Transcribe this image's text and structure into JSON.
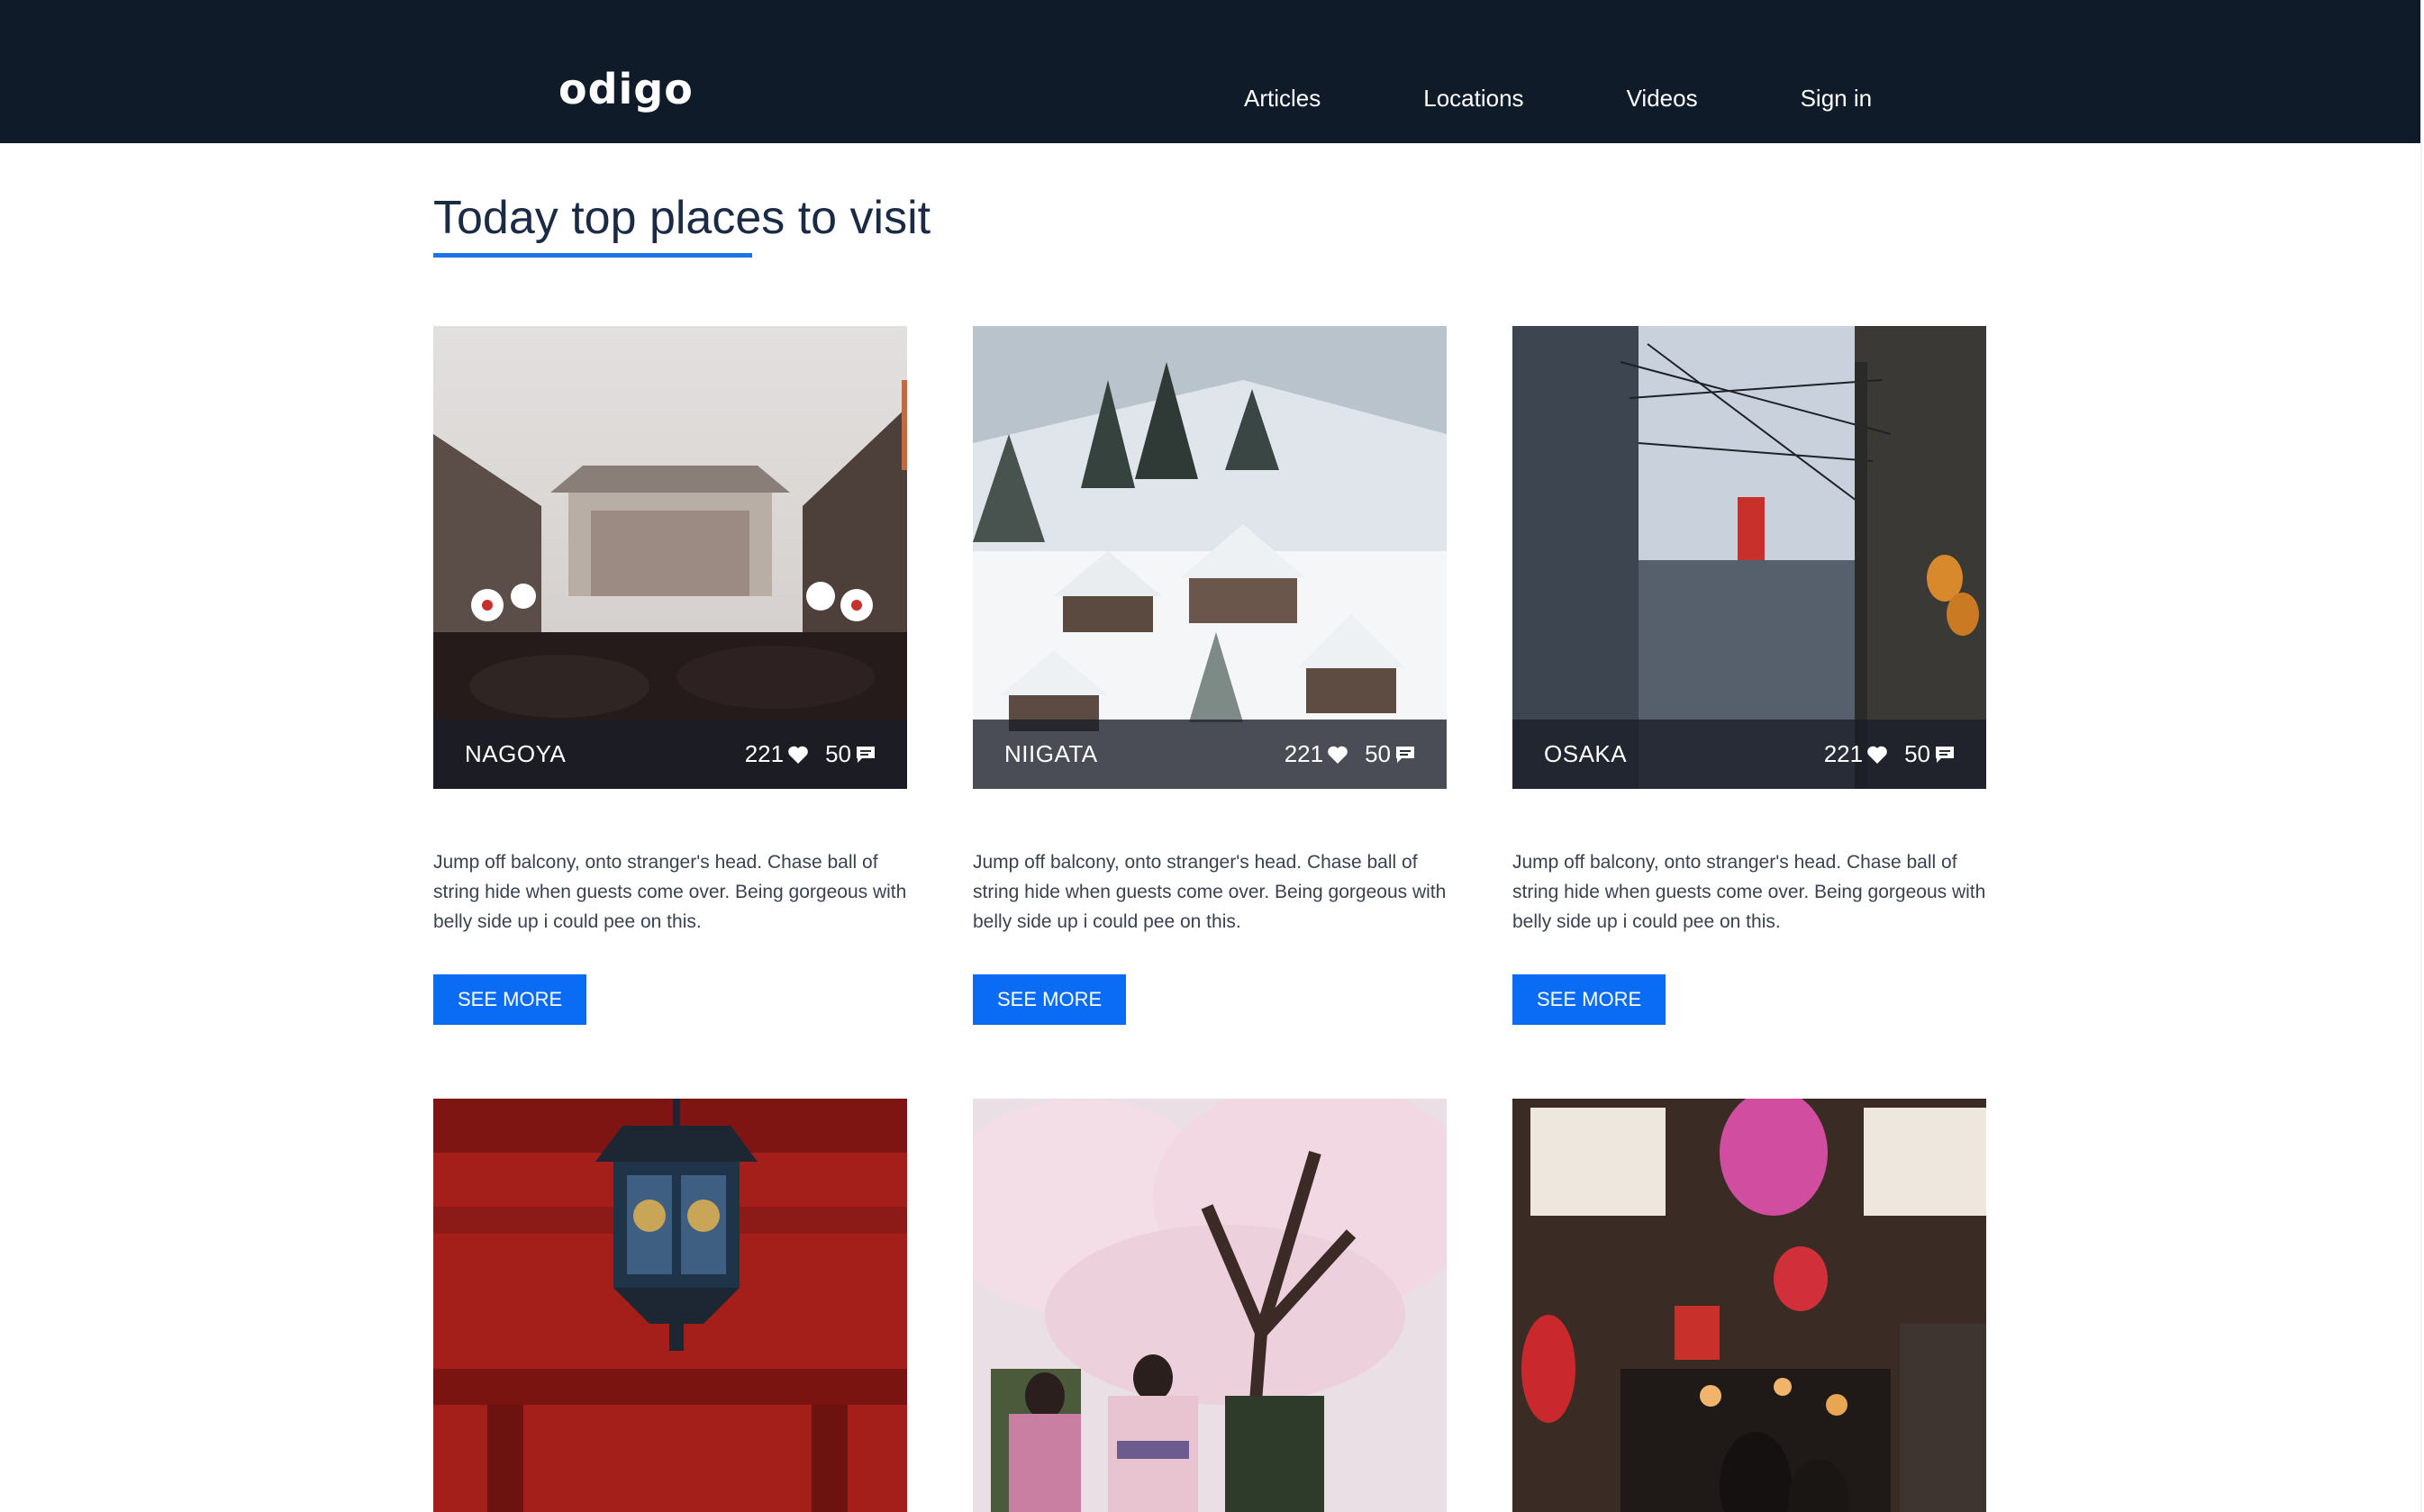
{
  "header": {
    "logo": "odigo",
    "nav": [
      "Articles",
      "Locations",
      "Videos",
      "Sign in"
    ]
  },
  "section": {
    "title": "Today top places to visit"
  },
  "cards": [
    {
      "city": "NAGOYA",
      "likes": "221",
      "comments": "50",
      "description": "Jump off balcony, onto stranger's head. Chase ball of string hide when guests come over. Being gorgeous with belly side up i could pee on this.",
      "button": "SEE MORE"
    },
    {
      "city": "NIIGATA",
      "likes": "221",
      "comments": "50",
      "description": "Jump off balcony, onto stranger's head. Chase ball of string hide when guests come over. Being gorgeous with belly side up i could pee on this.",
      "button": "SEE MORE"
    },
    {
      "city": "OSAKA",
      "likes": "221",
      "comments": "50",
      "description": "Jump off balcony, onto stranger's head. Chase ball of string hide when guests come over. Being gorgeous with belly side up i could pee on this.",
      "button": "SEE MORE"
    }
  ],
  "icons": {
    "like": "heart-icon",
    "comment": "comment-icon"
  },
  "colors": {
    "header_bg": "#0f1b29",
    "accent": "#0a6cf5",
    "title": "#1b2b45"
  }
}
